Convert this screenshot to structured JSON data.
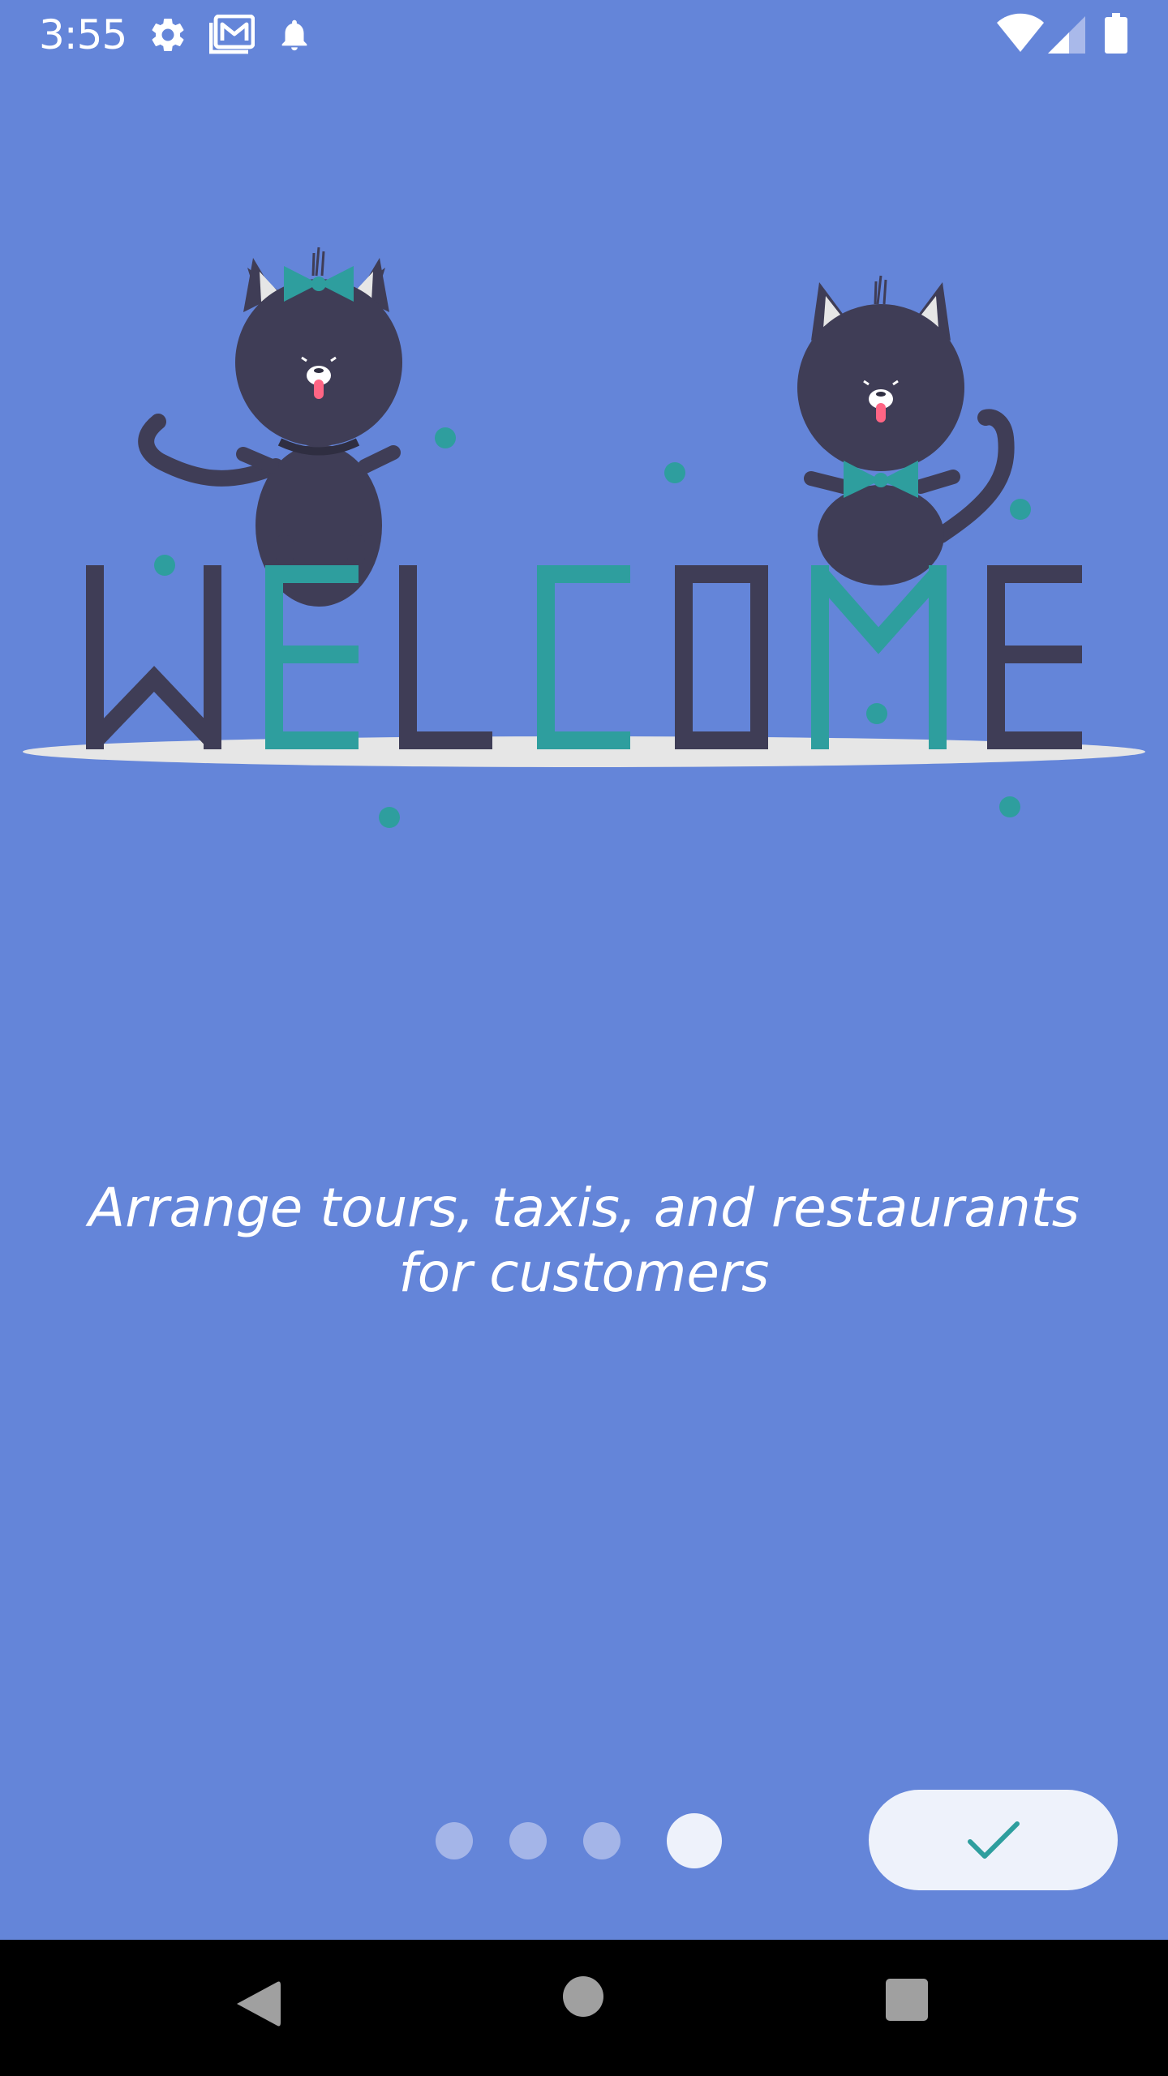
{
  "status_bar": {
    "time": "3:55",
    "icons": [
      "gear-icon",
      "mail-icon",
      "bell-icon",
      "wifi-icon",
      "signal-icon",
      "battery-icon"
    ]
  },
  "illustration": {
    "letters": [
      {
        "char": "W",
        "color": "#3F3D56"
      },
      {
        "char": "E",
        "color": "#2E9E9E"
      },
      {
        "char": "L",
        "color": "#3F3D56"
      },
      {
        "char": "C",
        "color": "#2E9E9E"
      },
      {
        "char": "O",
        "color": "#3F3D56"
      },
      {
        "char": "M",
        "color": "#2E9E9E"
      },
      {
        "char": "E",
        "color": "#3F3D56"
      }
    ]
  },
  "onboarding": {
    "message": "Arrange tours, taxis, and restaurants for customers"
  },
  "pager": {
    "page_count": 4,
    "current_page": 4
  },
  "done_button": {
    "icon": "check-icon",
    "icon_color": "#2E9E9E"
  },
  "navigation_bar": {
    "buttons": [
      "back-icon",
      "home-icon",
      "recents-icon"
    ]
  },
  "colors": {
    "background": "#6485D9",
    "accent": "#2E9E9E",
    "dark": "#3F3D56"
  }
}
